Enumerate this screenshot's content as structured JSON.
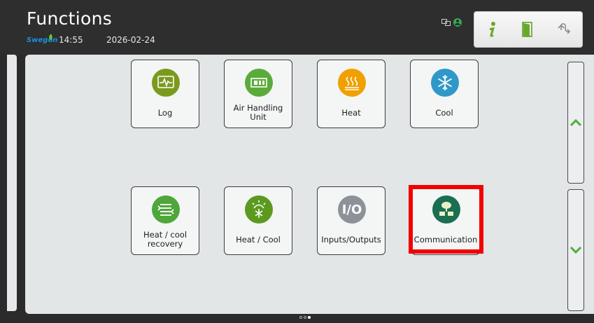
{
  "header": {
    "title": "Functions",
    "brand": "Swegon",
    "time": "14:55",
    "date": "2026-02-24",
    "status_icons": [
      "network-icon",
      "user-icon"
    ],
    "buttons": [
      {
        "name": "info-button",
        "icon": "info-icon"
      },
      {
        "name": "door-button",
        "icon": "door-icon"
      },
      {
        "name": "back-button",
        "icon": "back-arrow-icon"
      }
    ]
  },
  "tiles": [
    {
      "id": "log",
      "label": "Log",
      "icon": "trend-chart-icon",
      "color": "#7a9a1e"
    },
    {
      "id": "air-handling-unit",
      "label": "Air Handling\nUnit",
      "icon": "air-handling-unit-icon",
      "color": "#5aab3a"
    },
    {
      "id": "heat",
      "label": "Heat",
      "icon": "heat-icon",
      "color": "#f0a000"
    },
    {
      "id": "cool",
      "label": "Cool",
      "icon": "snowflake-icon",
      "color": "#2f98c9"
    },
    {
      "id": "heat-cool-recovery",
      "label": "Heat / cool\nrecovery",
      "icon": "heat-exchanger-icon",
      "color": "#4fa63a"
    },
    {
      "id": "heat-cool",
      "label": "Heat / Cool",
      "icon": "sun-snowflake-icon",
      "color": "#5b9a1f"
    },
    {
      "id": "inputs-outputs",
      "label": "Inputs/Outputs",
      "icon": "io-icon",
      "color": "#8c9298"
    },
    {
      "id": "communication",
      "label": "Communication",
      "icon": "communication-icon",
      "color": "#1a6e52"
    }
  ],
  "highlight_color": "#f20000",
  "scroll": {
    "up_icon": "chevron-up-icon",
    "down_icon": "chevron-down-icon",
    "color": "#4fae3c"
  },
  "page_indicator": {
    "current": 2,
    "total": 3
  }
}
